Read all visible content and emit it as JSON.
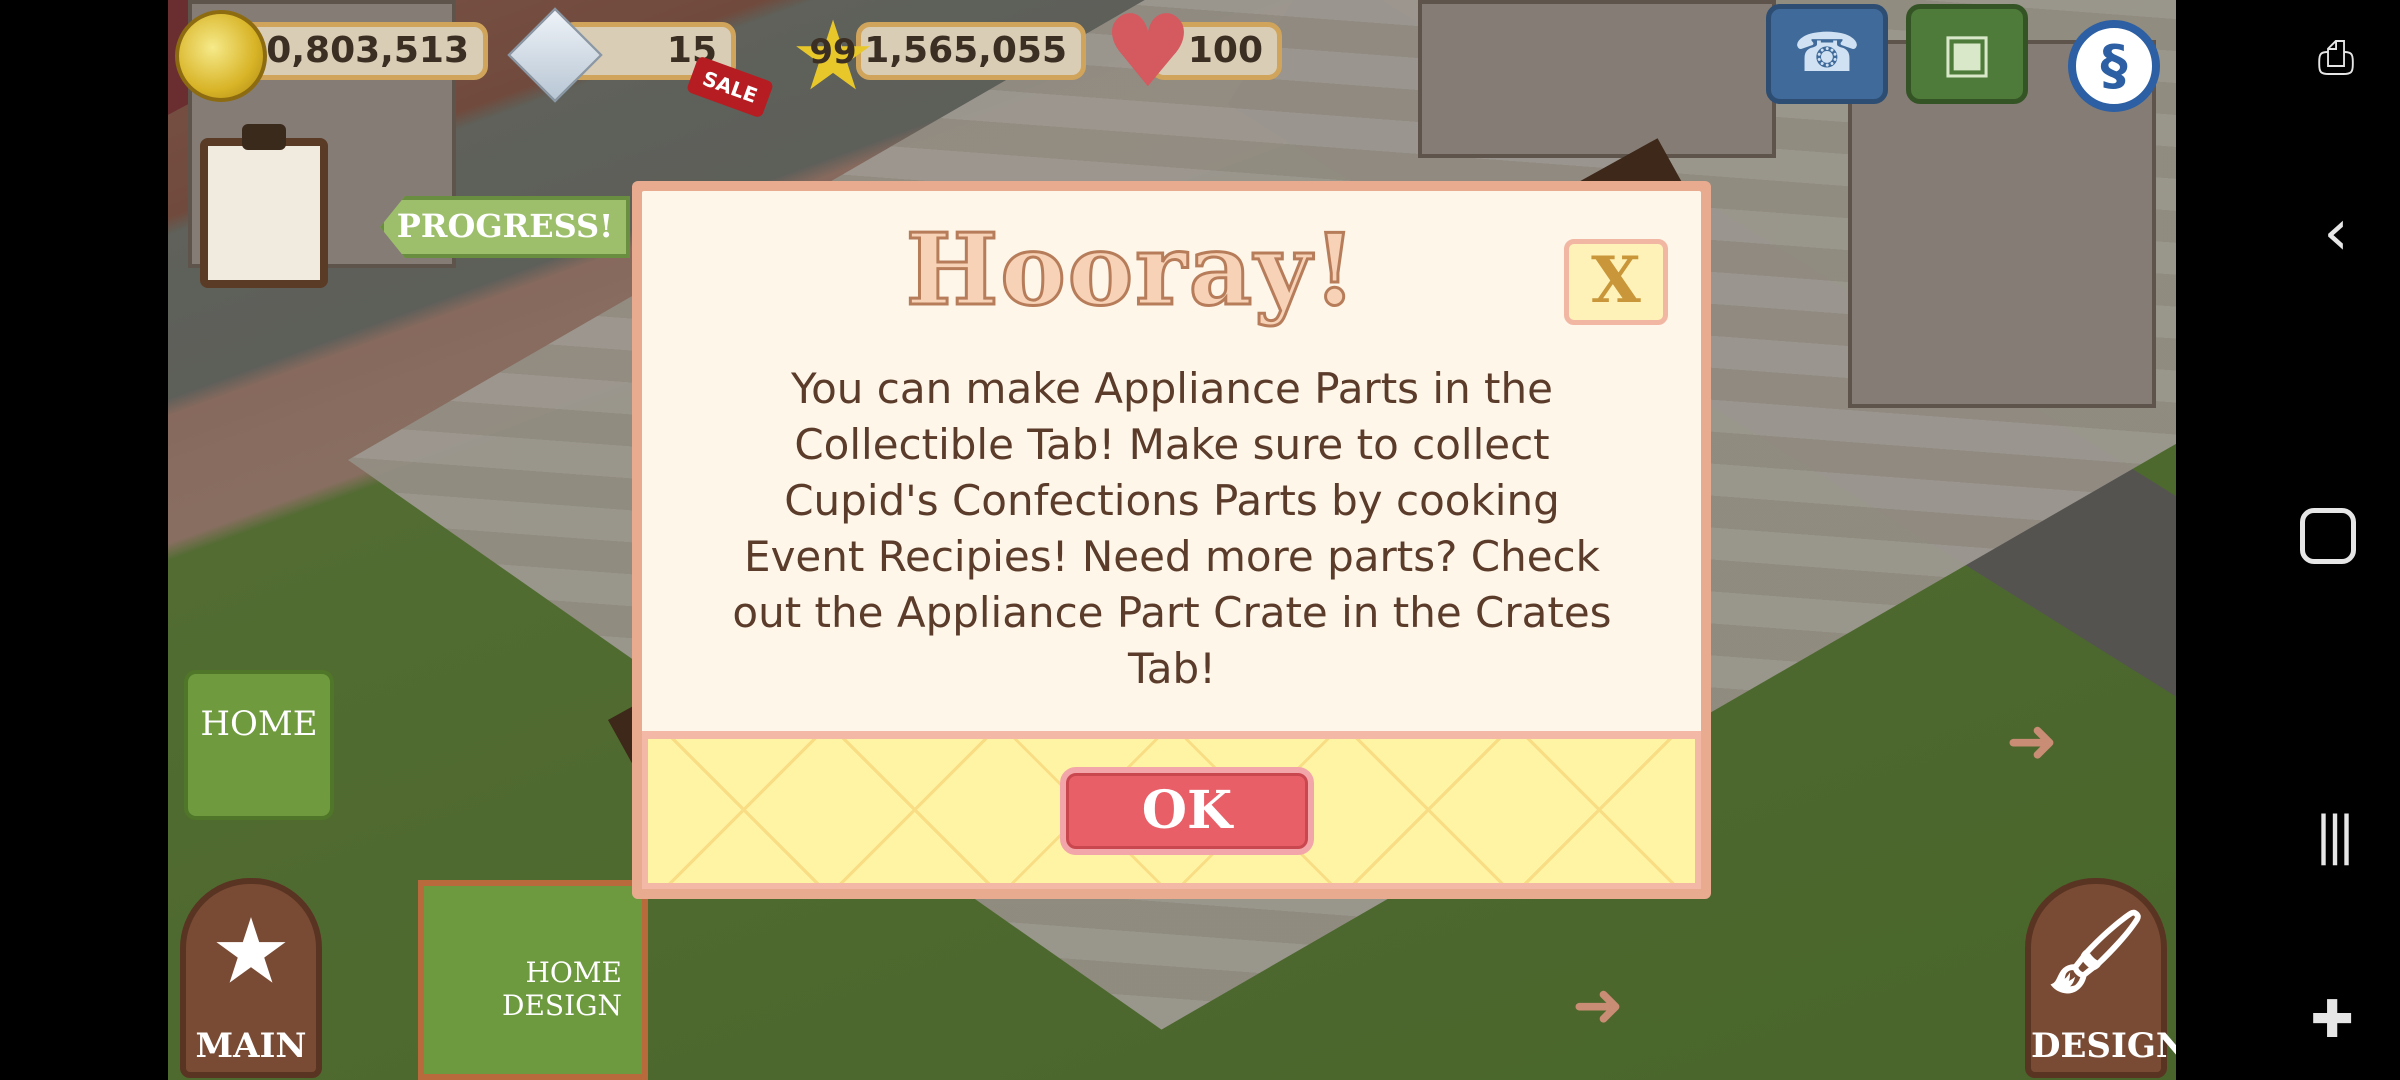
{
  "hud": {
    "coins": "40,803,513",
    "gems": "15",
    "sale_badge": "SALE",
    "level": "99",
    "xp": "1,565,055",
    "hearts": "100"
  },
  "side": {
    "progress_label": "PROGRESS!",
    "home_label": "HOME",
    "main_label": "MAIN",
    "design_label": "DESIGN",
    "book_label": "HOME DESIGN",
    "expand_label": "Expand"
  },
  "modal": {
    "title": "Hooray!",
    "close_label": "X",
    "message": "You can make Appliance Parts in the Collectible Tab! Make sure to collect Cupid's Confections Parts by cooking Event Recipies! Need more parts? Check out the Appliance Part Crate in the Crates Tab!",
    "ok_label": "OK"
  },
  "colors": {
    "modal_border": "#e8ab8f",
    "modal_bg": "#fdf6e9",
    "footer_bg": "#fff3a4",
    "ok_button": "#e85f68",
    "text": "#5b3b2a"
  },
  "icons": {
    "coin": "coin-icon",
    "gem": "gem-icon",
    "star": "star-icon",
    "heart": "heart-icon",
    "phone": "phone-icon",
    "camera": "camera-icon",
    "s_badge": "s-badge-icon",
    "nav_back": "back-icon",
    "nav_home": "home-icon",
    "nav_recents": "recents-icon"
  }
}
